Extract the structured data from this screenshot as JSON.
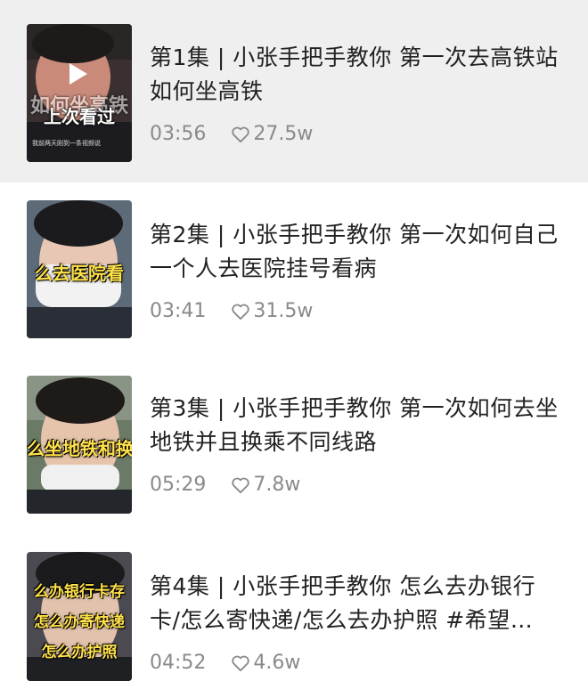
{
  "episodes": [
    {
      "title": "第1集 | 小张手把手教你 第一次去高铁站如何坐高铁",
      "duration": "03:56",
      "likes": "27.5w",
      "thumb_caption": "上次看过",
      "thumb_caption_bg": "如何坐高铁",
      "thumb_subcaption": "我前两天刚到一条视频说"
    },
    {
      "title": "第2集 | 小张手把手教你 第一次如何自己一个人去医院挂号看病",
      "duration": "03:41",
      "likes": "31.5w",
      "thumb_caption": "么去医院看"
    },
    {
      "title": "第3集 | 小张手把手教你 第一次如何去坐地铁并且换乘不同线路",
      "duration": "05:29",
      "likes": "7.8w",
      "thumb_caption": "么坐地铁和换"
    },
    {
      "title": "第4集 | 小张手把手教你 怎么去办银行卡/怎么寄快递/怎么去办护照 #希望…",
      "duration": "04:52",
      "likes": "4.6w",
      "thumb_captions": [
        "么办银行卡存",
        "怎么办寄快递",
        "怎么办护照"
      ]
    }
  ],
  "colors": {
    "active_bg": "#efefef",
    "title": "#222222",
    "meta": "#8a8a8a",
    "caption_yellow": "#ffe14a"
  },
  "icons": {
    "play": "play-icon",
    "like": "heart-outline-icon"
  }
}
